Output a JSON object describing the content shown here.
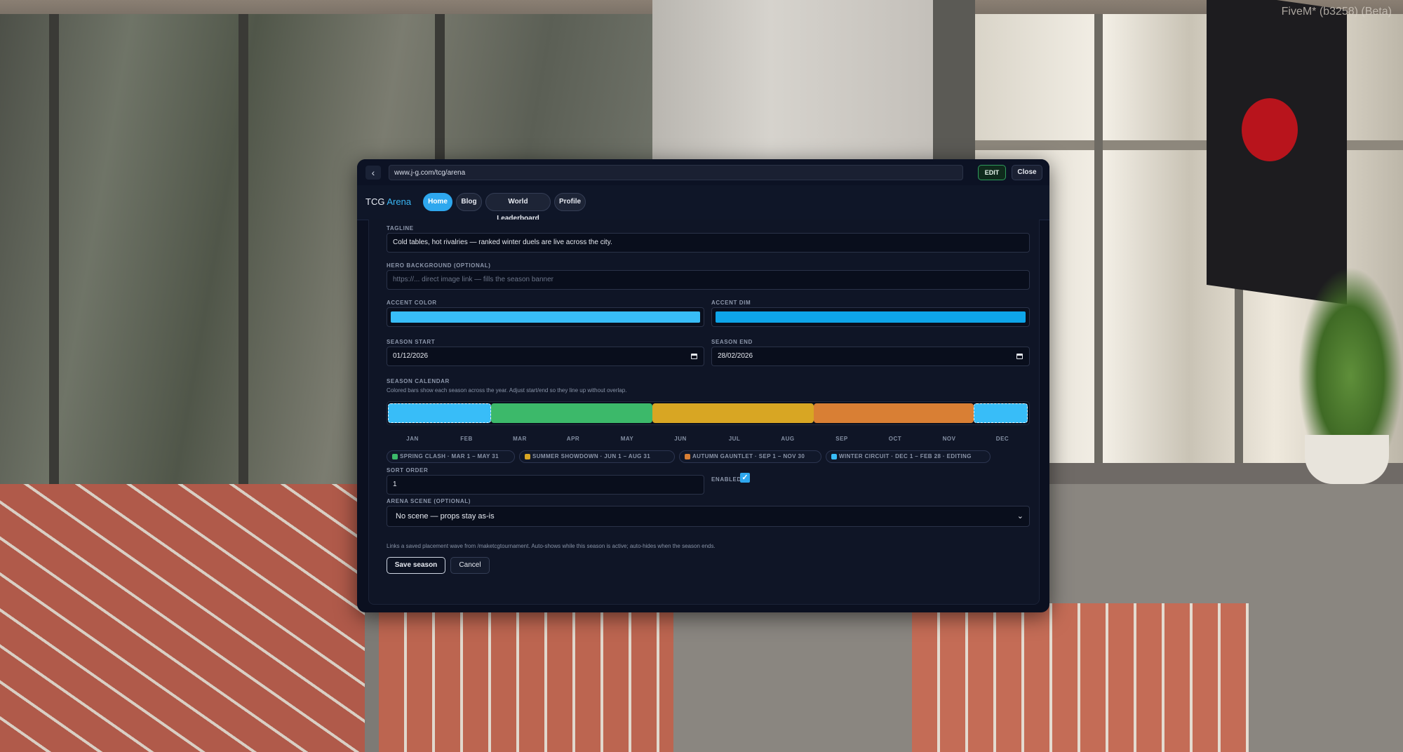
{
  "hud": {
    "title": "FiveM* (b3258) (Beta)"
  },
  "browser": {
    "back_icon": "‹",
    "url": "www.j-g.com/tcg/arena",
    "edit_label": "EDIT",
    "close_label": "Close"
  },
  "nav": {
    "brand_main": "TCG",
    "brand_accent": "Arena",
    "tabs": [
      {
        "label": "Home",
        "active": true
      },
      {
        "label": "Blog",
        "active": false
      },
      {
        "label": "World Leaderboard",
        "active": false
      },
      {
        "label": "Profile",
        "active": false
      }
    ]
  },
  "form": {
    "tagline_label": "TAGLINE",
    "tagline_value": "Cold tables, hot rivalries — ranked winter duels are live across the city.",
    "hero_label": "HERO BACKGROUND (OPTIONAL)",
    "hero_placeholder": "https://... direct image link — fills the season banner",
    "accent_color_label": "ACCENT COLOR",
    "accent_color_value": "#38bdf8",
    "accent_dim_label": "ACCENT DIM",
    "accent_dim_value": "#0ea5e9",
    "season_start_label": "SEASON START",
    "season_start_value": "01/12/2026",
    "season_end_label": "SEASON END",
    "season_end_value": "28/02/2026",
    "calendar_label": "SEASON CALENDAR",
    "calendar_hint": "Colored bars show each season across the year. Adjust start/end so they line up without overlap.",
    "months": [
      "JAN",
      "FEB",
      "MAR",
      "APR",
      "MAY",
      "JUN",
      "JUL",
      "AUG",
      "SEP",
      "OCT",
      "NOV",
      "DEC"
    ],
    "seasons": [
      {
        "label": "SPRING CLASH · MAR 1 – MAY 31",
        "color": "#3cb96a"
      },
      {
        "label": "SUMMER SHOWDOWN · JUN 1 – AUG 31",
        "color": "#d8a623"
      },
      {
        "label": "AUTUMN GAUNTLET · SEP 1 – NOV 30",
        "color": "#d97f34"
      },
      {
        "label": "WINTER CIRCUIT · DEC 1 – FEB 28 · EDITING",
        "color": "#38bdf8"
      }
    ],
    "sort_order_label": "SORT ORDER",
    "sort_order_value": "1",
    "enabled_label": "ENABLED",
    "enabled_check": "✓",
    "arena_scene_label": "ARENA SCENE (OPTIONAL)",
    "arena_scene_value": "No scene — props stay as-is",
    "arena_scene_chevron": "⌄",
    "arena_hint": "Links a saved placement wave from /maketcgtournament. Auto-shows while this season is active; auto-hides when the season ends.",
    "save_label": "Save season",
    "cancel_label": "Cancel"
  }
}
